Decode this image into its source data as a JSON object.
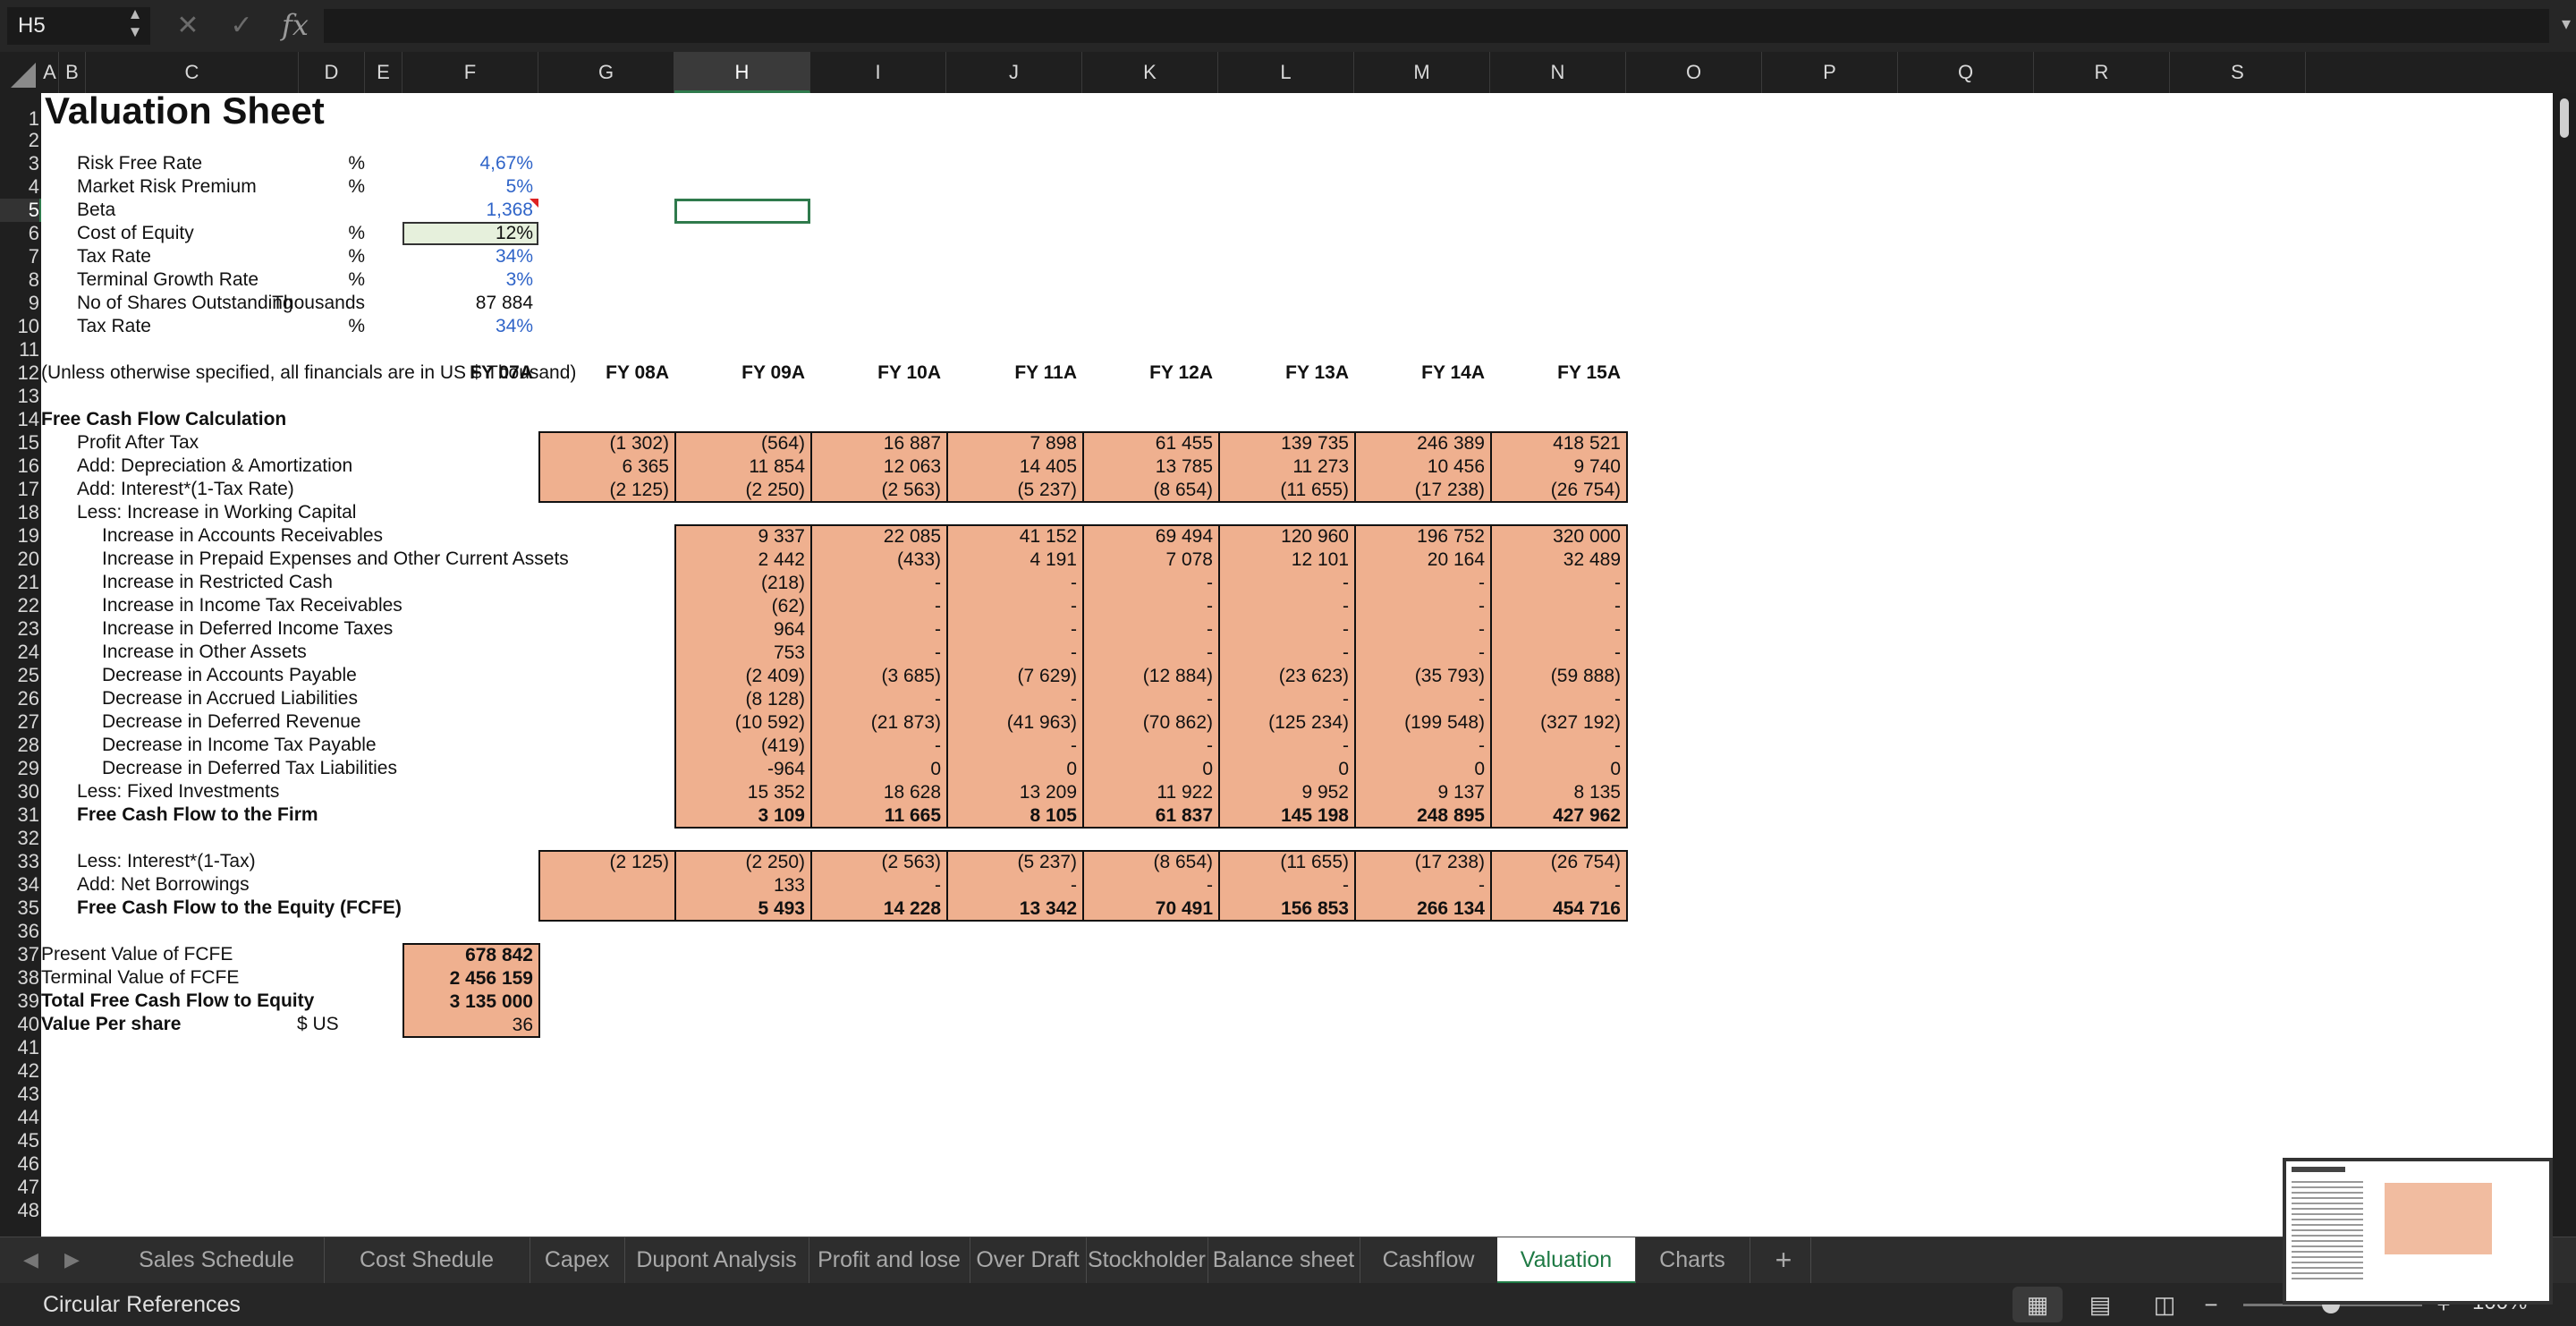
{
  "formula_bar": {
    "name_box": "H5",
    "formula": "",
    "fx": "fx",
    "cancel": "✕",
    "confirm": "✓"
  },
  "columns": [
    "A",
    "B",
    "C",
    "D",
    "E",
    "F",
    "G",
    "H",
    "I",
    "J",
    "K",
    "L",
    "M",
    "N",
    "O",
    "P",
    "Q",
    "R",
    "S"
  ],
  "selected_column": "H",
  "rows": [
    "1",
    "2",
    "3",
    "4",
    "5",
    "6",
    "7",
    "8",
    "9",
    "10",
    "11",
    "12",
    "13",
    "14",
    "15",
    "16",
    "17",
    "18",
    "19",
    "20",
    "21",
    "22",
    "23",
    "24",
    "25",
    "26",
    "27",
    "28",
    "29",
    "30",
    "31",
    "32",
    "33",
    "34",
    "35",
    "36",
    "37",
    "38",
    "39",
    "40",
    "41",
    "42",
    "43",
    "44",
    "45",
    "46",
    "47",
    "48"
  ],
  "selected_row": "5",
  "sheet": {
    "title": "Valuation Sheet",
    "assumptions": [
      {
        "label": "Risk Free Rate",
        "unit": "%",
        "value": "4,67%"
      },
      {
        "label": "Market Risk Premium",
        "unit": "%",
        "value": "5%"
      },
      {
        "label": "Beta",
        "unit": "",
        "value": "1,368"
      },
      {
        "label": "Cost of Equity",
        "unit": "%",
        "value": "12%"
      },
      {
        "label": "Tax Rate",
        "unit": "%",
        "value": "34%"
      },
      {
        "label": "Terminal Growth Rate",
        "unit": "%",
        "value": "3%"
      },
      {
        "label": "No of Shares Outstanding",
        "unit": "Thousands",
        "value": "87 884"
      },
      {
        "label": "Tax Rate",
        "unit": "%",
        "value": "34%"
      }
    ],
    "financials_note": "(Unless otherwise specified, all financials are in US $ Thousand)",
    "years": [
      "FY 07A",
      "FY 08A",
      "FY 09A",
      "FY 10A",
      "FY 11A",
      "FY 12A",
      "FY 13A",
      "FY 14A",
      "FY 15A"
    ],
    "fcf_header": "Free Cash Flow Calculation",
    "block1": [
      {
        "label": "Profit After Tax",
        "values": [
          "(1 302)",
          "(564)",
          "16 887",
          "7 898",
          "61 455",
          "139 735",
          "246 389",
          "418 521"
        ]
      },
      {
        "label": "Add: Depreciation & Amortization",
        "values": [
          "6 365",
          "11 854",
          "12 063",
          "14 405",
          "13 785",
          "11 273",
          "10 456",
          "9 740"
        ]
      },
      {
        "label": "Add: Interest*(1-Tax Rate)",
        "values": [
          "(2 125)",
          "(2 250)",
          "(2 563)",
          "(5 237)",
          "(8 654)",
          "(11 655)",
          "(17 238)",
          "(26 754)"
        ]
      }
    ],
    "wc_label": "Less: Increase in Working Capital",
    "block2": [
      {
        "label": "Increase in Accounts Receivables",
        "values": [
          "9 337",
          "22 085",
          "41 152",
          "69 494",
          "120 960",
          "196 752",
          "320 000"
        ]
      },
      {
        "label": "Increase in Prepaid Expenses and Other Current Assets",
        "values": [
          "2 442",
          "(433)",
          "4 191",
          "7 078",
          "12 101",
          "20 164",
          "32 489"
        ]
      },
      {
        "label": "Increase in Restricted Cash",
        "values": [
          "(218)",
          "-",
          "-",
          "-",
          "-",
          "-",
          "-"
        ]
      },
      {
        "label": "Increase in Income Tax Receivables",
        "values": [
          "(62)",
          "-",
          "-",
          "-",
          "-",
          "-",
          "-"
        ]
      },
      {
        "label": "Increase in Deferred Income Taxes",
        "values": [
          "964",
          "-",
          "-",
          "-",
          "-",
          "-",
          "-"
        ]
      },
      {
        "label": "Increase in Other Assets",
        "values": [
          "753",
          "-",
          "-",
          "-",
          "-",
          "-",
          "-"
        ]
      },
      {
        "label": "Decrease in Accounts Payable",
        "values": [
          "(2 409)",
          "(3 685)",
          "(7 629)",
          "(12 884)",
          "(23 623)",
          "(35 793)",
          "(59 888)"
        ]
      },
      {
        "label": "Decrease in Accrued Liabilities",
        "values": [
          "(8 128)",
          "-",
          "-",
          "-",
          "-",
          "-",
          "-"
        ]
      },
      {
        "label": "Decrease in Deferred Revenue",
        "values": [
          "(10 592)",
          "(21 873)",
          "(41 963)",
          "(70 862)",
          "(125 234)",
          "(199 548)",
          "(327 192)"
        ]
      },
      {
        "label": "Decrease in Income Tax Payable",
        "values": [
          "(419)",
          "-",
          "-",
          "-",
          "-",
          "-",
          "-"
        ]
      },
      {
        "label": "Decrease in Deferred Tax Liabilities",
        "values": [
          "-964",
          "0",
          "0",
          "0",
          "0",
          "0",
          "0"
        ]
      },
      {
        "label": "Less: Fixed Investments",
        "values": [
          "15 352",
          "18 628",
          "13 209",
          "11 922",
          "9 952",
          "9 137",
          "8 135"
        ]
      },
      {
        "label": "Free Cash Flow to the Firm",
        "values": [
          "3 109",
          "11 665",
          "8 105",
          "61 837",
          "145 198",
          "248 895",
          "427 962"
        ]
      }
    ],
    "block3": [
      {
        "label": "Less: Interest*(1-Tax)",
        "values": [
          "(2 125)",
          "(2 250)",
          "(2 563)",
          "(5 237)",
          "(8 654)",
          "(11 655)",
          "(17 238)",
          "(26 754)"
        ]
      },
      {
        "label": "Add: Net Borrowings",
        "values": [
          "",
          "133",
          "-",
          "-",
          "-",
          "-",
          "-",
          "-"
        ]
      },
      {
        "label": "Free Cash Flow to the Equity (FCFE)",
        "values": [
          "",
          "5 493",
          "14 228",
          "13 342",
          "70 491",
          "156 853",
          "266 134",
          "454 716"
        ]
      }
    ],
    "summary": [
      {
        "label": "Present Value of FCFE",
        "unit": "",
        "value": "678 842"
      },
      {
        "label": "Terminal Value of FCFE",
        "unit": "",
        "value": "2 456 159"
      },
      {
        "label": "Total Free Cash Flow to Equity",
        "unit": "",
        "value": "3 135 000"
      },
      {
        "label": "Value Per share",
        "unit": "$ US",
        "value": "36"
      }
    ]
  },
  "tabs": [
    "Sales Schedule",
    "Cost Shedule",
    "Capex",
    "Dupont Analysis",
    "Profit and lose",
    "Over Draft",
    "Stockholder",
    "Balance sheet",
    "Cashflow",
    "Valuation",
    "Charts"
  ],
  "active_tab": "Valuation",
  "add_sheet": "+",
  "status": {
    "text": "Circular References",
    "zoom": "100%"
  },
  "colors": {
    "fill": "#efb08f",
    "accent": "#1f7a45",
    "input_blue": "#2f64c8"
  }
}
